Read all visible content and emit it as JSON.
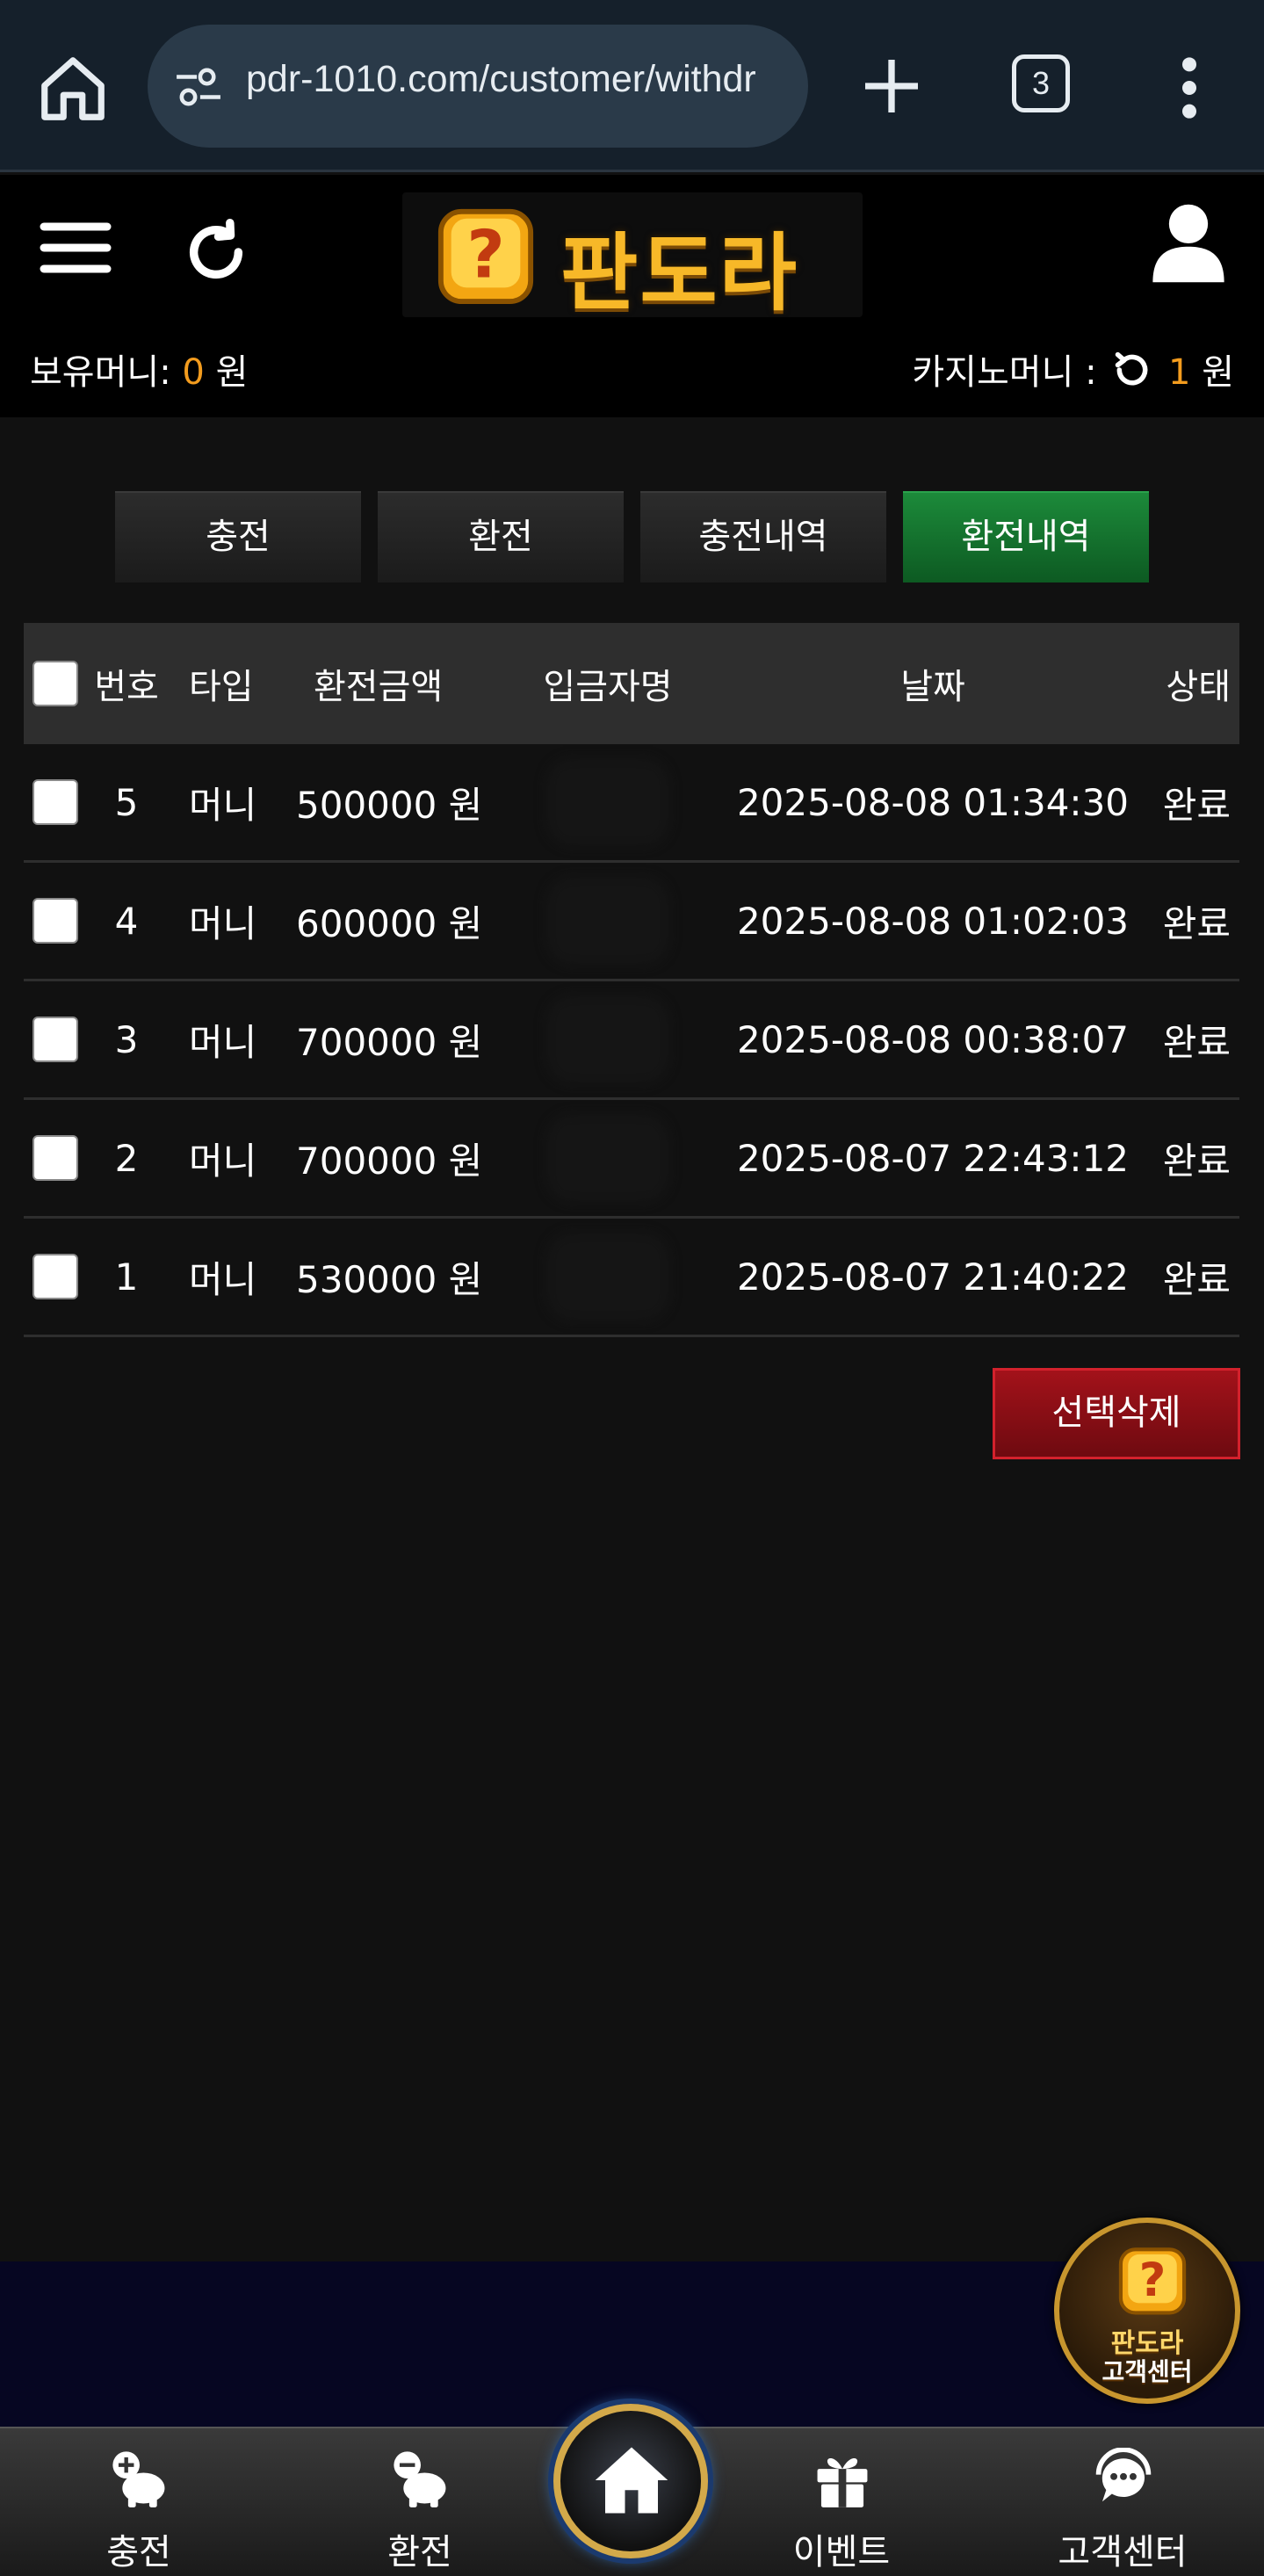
{
  "browser": {
    "url": "pdr-1010.com/customer/withdr",
    "tab_count": "3"
  },
  "header": {
    "logo_text": "판도라",
    "money_label": "보유머니:",
    "money_value": "0",
    "money_unit": "원",
    "casino_label": "카지노머니 :",
    "casino_value": "1",
    "casino_unit": "원"
  },
  "tabs": [
    {
      "label": "충전",
      "active": false
    },
    {
      "label": "환전",
      "active": false
    },
    {
      "label": "충전내역",
      "active": false
    },
    {
      "label": "환전내역",
      "active": true
    }
  ],
  "table": {
    "headers": {
      "num": "번호",
      "type": "타입",
      "amount": "환전금액",
      "depositor": "입금자명",
      "date": "날짜",
      "status": "상태"
    },
    "rows": [
      {
        "num": "5",
        "type": "머니",
        "amount": "500000 원",
        "date": "2025-08-08 01:34:30",
        "status": "완료"
      },
      {
        "num": "4",
        "type": "머니",
        "amount": "600000 원",
        "date": "2025-08-08 01:02:03",
        "status": "완료"
      },
      {
        "num": "3",
        "type": "머니",
        "amount": "700000 원",
        "date": "2025-08-08 00:38:07",
        "status": "완료"
      },
      {
        "num": "2",
        "type": "머니",
        "amount": "700000 원",
        "date": "2025-08-07 22:43:12",
        "status": "완료"
      },
      {
        "num": "1",
        "type": "머니",
        "amount": "530000 원",
        "date": "2025-08-07 21:40:22",
        "status": "완료"
      }
    ]
  },
  "delete_button": "선택삭제",
  "customer_center_badge": {
    "line1": "판도라",
    "line2": "고객센터"
  },
  "bottom_nav": {
    "charge": "충전",
    "exchange": "환전",
    "event": "이벤트",
    "support": "고객센터"
  },
  "colors": {
    "accent_orange": "#f39c1e",
    "active_tab": "#1c8a3a",
    "delete_red": "#a3121a"
  }
}
